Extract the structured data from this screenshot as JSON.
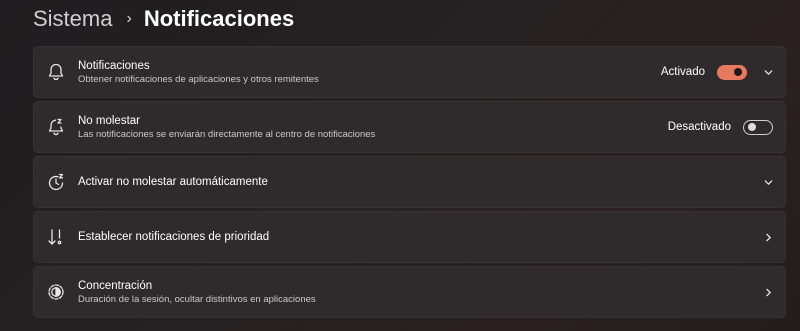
{
  "breadcrumb": {
    "parent": "Sistema",
    "separator": "›",
    "current": "Notificaciones"
  },
  "accent_color": "#e8795f",
  "settings": [
    {
      "title": "Notificaciones",
      "subtitle": "Obtener notificaciones de aplicaciones y otros remitentes",
      "state": "Activado",
      "toggle": "on",
      "icon": "bell-icon",
      "action": "chevron-down-icon"
    },
    {
      "title": "No molestar",
      "subtitle": "Las notificaciones se enviarán directamente al centro de notificaciones",
      "state": "Desactivado",
      "toggle": "off",
      "icon": "bell-snooze-icon",
      "action": "none"
    },
    {
      "title": "Activar no molestar automáticamente",
      "icon": "clock-snooze-icon",
      "action": "chevron-down-icon"
    },
    {
      "title": "Establecer notificaciones de prioridad",
      "icon": "priority-sort-icon",
      "action": "chevron-right-icon"
    },
    {
      "title": "Concentración",
      "subtitle": "Duración de la sesión, ocultar distintivos en aplicaciones",
      "icon": "focus-icon",
      "action": "chevron-right-icon"
    }
  ]
}
